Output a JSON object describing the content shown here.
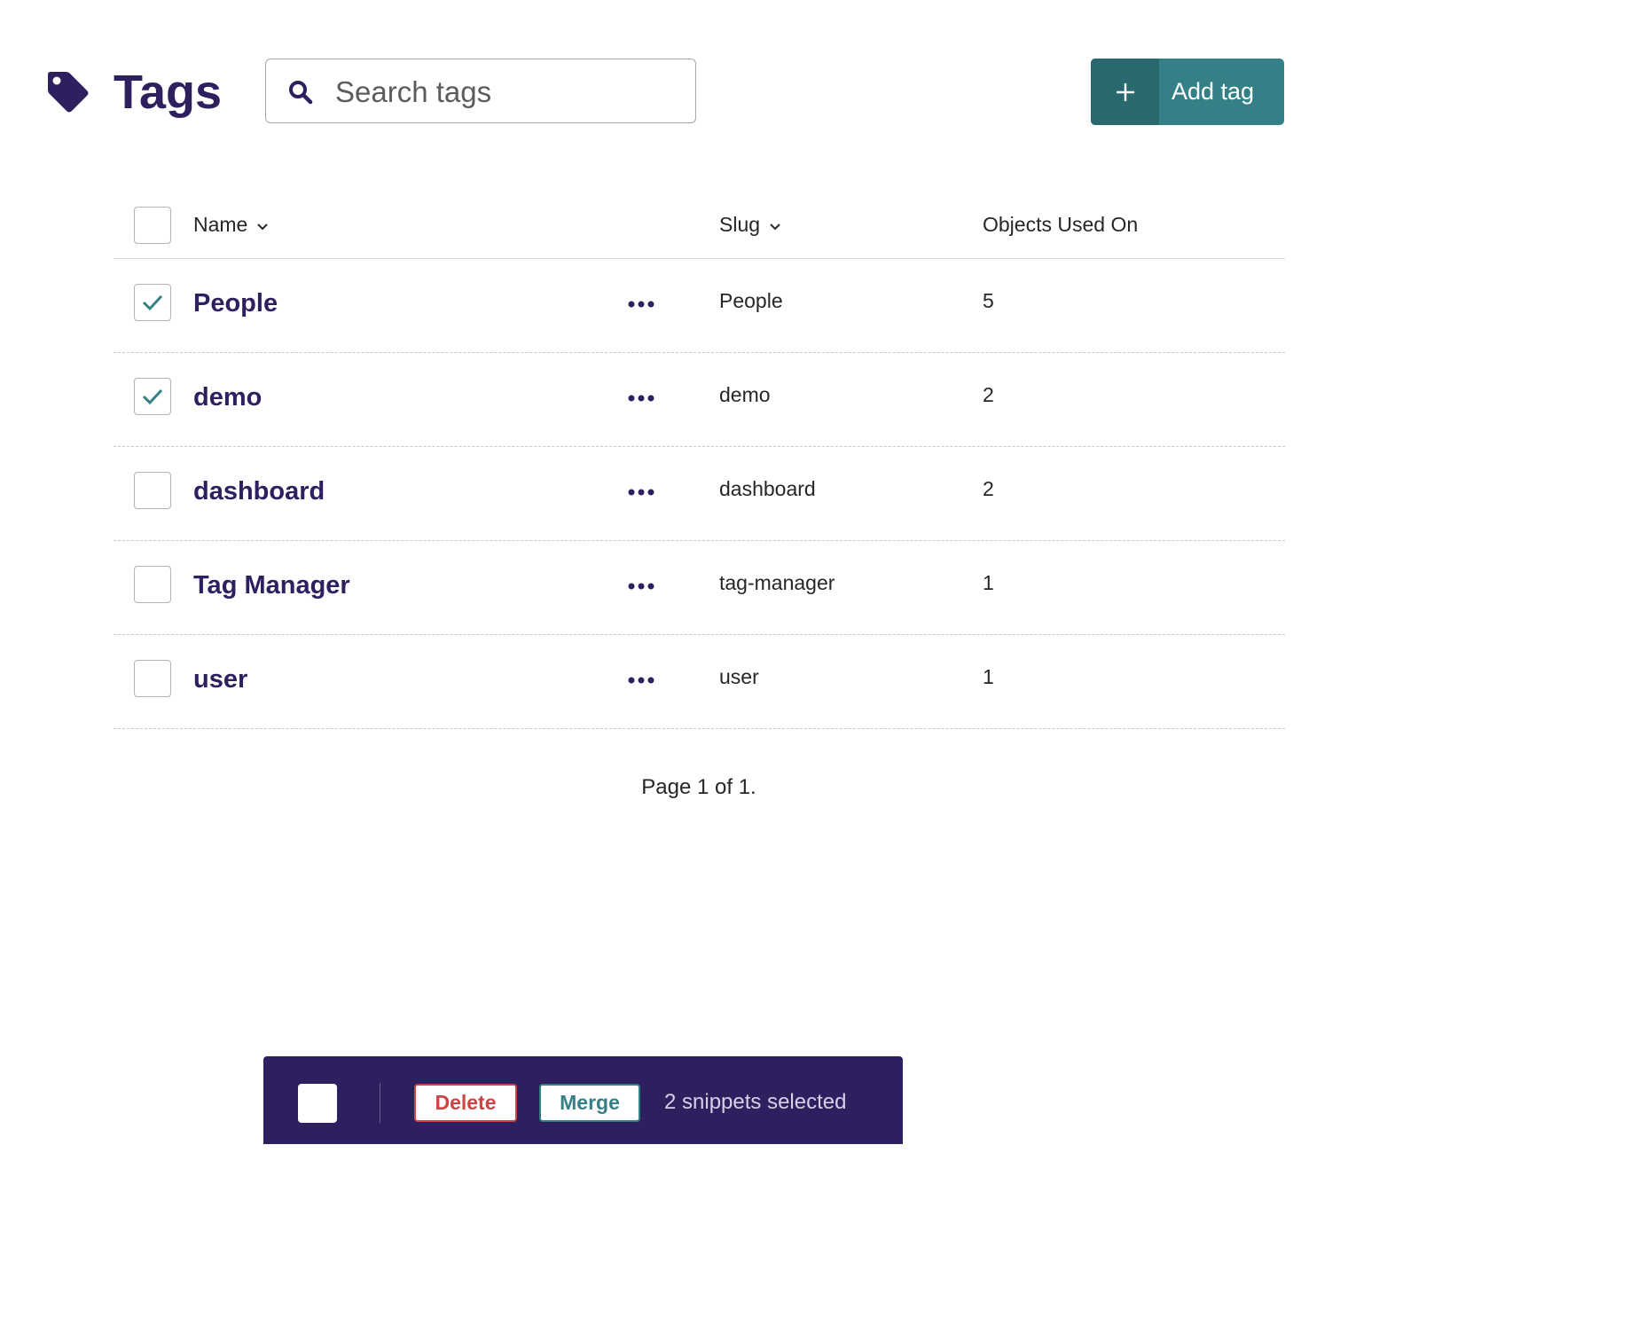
{
  "header": {
    "title": "Tags",
    "icon": "tag-icon",
    "search_placeholder": "Search tags",
    "search_value": "",
    "add_button_label": "Add tag"
  },
  "table": {
    "columns": {
      "name": "Name",
      "slug": "Slug",
      "objects_used_on": "Objects Used On"
    },
    "rows": [
      {
        "name": "People",
        "slug": "People",
        "count": "5",
        "selected": true
      },
      {
        "name": "demo",
        "slug": "demo",
        "count": "2",
        "selected": true
      },
      {
        "name": "dashboard",
        "slug": "dashboard",
        "count": "2",
        "selected": false
      },
      {
        "name": "Tag Manager",
        "slug": "tag-manager",
        "count": "1",
        "selected": false
      },
      {
        "name": "user",
        "slug": "user",
        "count": "1",
        "selected": false
      }
    ]
  },
  "pagination": {
    "text": "Page 1 of 1."
  },
  "bulk_actions": {
    "delete_label": "Delete",
    "merge_label": "Merge",
    "status": "2 snippets selected"
  },
  "colors": {
    "primary_dark": "#2e1f5e",
    "teal": "#358086",
    "teal_dark": "#29686d",
    "danger": "#cd4444"
  }
}
